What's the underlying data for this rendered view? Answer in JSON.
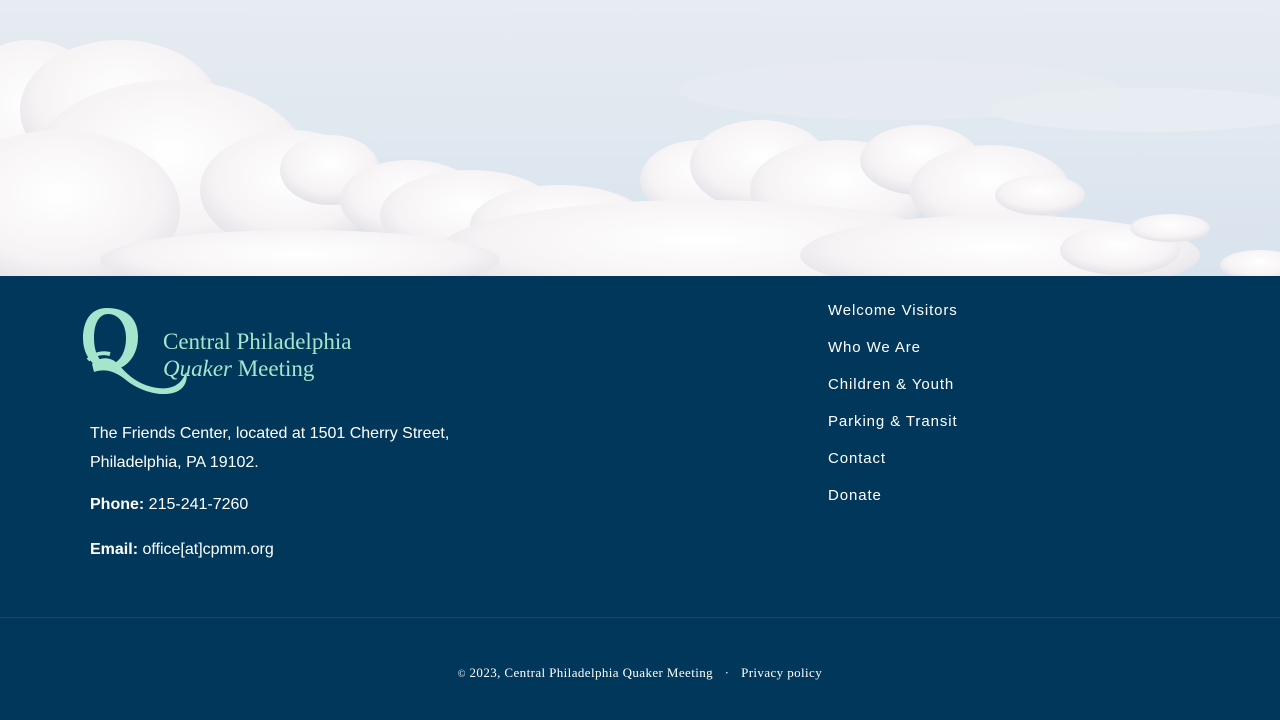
{
  "hero": {
    "image": "sky-with-clouds"
  },
  "logo": {
    "line1": "Central Philadelphia",
    "line2_italic": "Quaker",
    "line2_rest": "Meeting",
    "mark": "Q",
    "color": "#a4e6cd"
  },
  "address": "The Friends Center, located at 1501 Cherry Street, Philadelphia, PA 19102.",
  "phone": {
    "label": "Phone:",
    "value": "215-241-7260"
  },
  "email": {
    "label": "Email:",
    "value": "office[at]cpmm.org"
  },
  "nav": [
    "Welcome Visitors",
    "Who We Are",
    "Children & Youth",
    "Parking & Transit",
    "Contact",
    "Donate"
  ],
  "bottom": {
    "copyright_symbol": "©",
    "copyright_text": "2023, Central Philadelphia Quaker Meeting",
    "separator": "·",
    "privacy": "Privacy policy"
  },
  "colors": {
    "footer_bg": "#01375a",
    "accent": "#a4e6cd"
  }
}
